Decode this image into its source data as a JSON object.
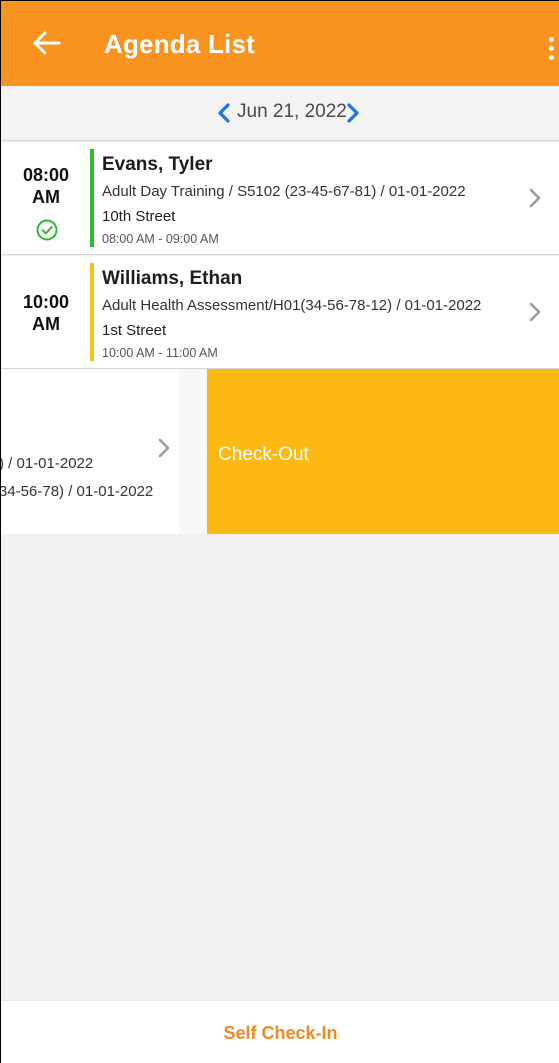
{
  "appbar": {
    "title": "Agenda List"
  },
  "date_nav": {
    "date": "Jun 21, 2022"
  },
  "colors": {
    "header": "#f7931e",
    "accent_green": "#2eb82e",
    "accent_yellow": "#f5c11c",
    "date_arrow": "#1a73e8",
    "checkout": "#fdb913",
    "self_checkin_text": "#f08a24"
  },
  "appointments": [
    {
      "time": "08:00",
      "ampm": "AM",
      "name": "Evans, Tyler",
      "service": "Adult Day Training / S5102 (23-45-67-81) / 01-01-2022",
      "street": "10th Street",
      "range": "08:00 AM - 09:00 AM",
      "status_icon": "check-circle-icon",
      "checked_in": true
    },
    {
      "time": "10:00",
      "ampm": "AM",
      "name": "Williams, Ethan",
      "service": "Adult Health Assessment/H01(34-56-78-12) / 01-01-2022",
      "street": "1st Street",
      "range": "10:00 AM - 11:00 AM",
      "checked_in": false
    }
  ],
  "swiped_row": {
    "line1": ") / 01-01-2022",
    "line2": "34-56-78) / 01-01-2022",
    "action_label": "Check-Out"
  },
  "bottom": {
    "self_checkin_label": "Self Check-In"
  }
}
